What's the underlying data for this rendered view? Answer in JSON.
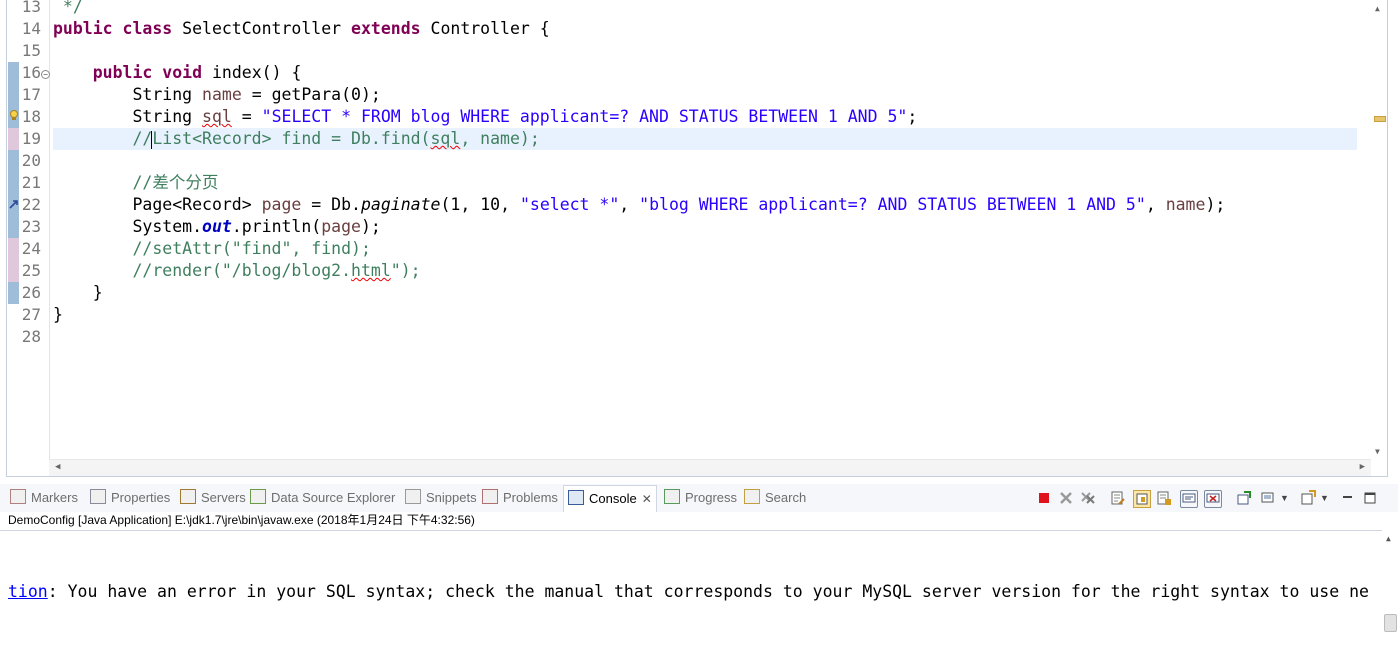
{
  "editor": {
    "lines": [
      {
        "num": "13",
        "parts": [
          {
            "t": " */",
            "c": "cmt"
          }
        ]
      },
      {
        "num": "14",
        "parts": [
          {
            "t": "public class ",
            "c": "kw"
          },
          {
            "t": "SelectController ",
            "c": ""
          },
          {
            "t": "extends ",
            "c": "kw"
          },
          {
            "t": "Controller {",
            "c": ""
          }
        ]
      },
      {
        "num": "15",
        "parts": []
      },
      {
        "num": "16",
        "fold": true,
        "parts": [
          {
            "t": "    ",
            "c": ""
          },
          {
            "t": "public void ",
            "c": "kw"
          },
          {
            "t": "index() {",
            "c": ""
          }
        ]
      },
      {
        "num": "17",
        "parts": [
          {
            "t": "        String ",
            "c": ""
          },
          {
            "t": "name",
            "c": "var"
          },
          {
            "t": " = getPara(0);",
            "c": ""
          }
        ]
      },
      {
        "num": "18",
        "warning": true,
        "parts": [
          {
            "t": "        String ",
            "c": ""
          },
          {
            "t": "sql",
            "c": "var squig"
          },
          {
            "t": " = ",
            "c": ""
          },
          {
            "t": "\"SELECT * FROM blog WHERE applicant=? AND STATUS BETWEEN 1 AND 5\"",
            "c": "str"
          },
          {
            "t": ";",
            "c": ""
          }
        ]
      },
      {
        "num": "19",
        "current": true,
        "parts": [
          {
            "t": "        //",
            "c": "cmt"
          },
          {
            "t": "",
            "c": "caret"
          },
          {
            "t": "List<Record> find = Db.find(",
            "c": "cmt"
          },
          {
            "t": "sql",
            "c": "cmt squig"
          },
          {
            "t": ", name);",
            "c": "cmt"
          }
        ]
      },
      {
        "num": "20",
        "parts": []
      },
      {
        "num": "21",
        "parts": [
          {
            "t": "        //差个分页",
            "c": "cmt"
          }
        ]
      },
      {
        "num": "22",
        "link": true,
        "parts": [
          {
            "t": "        Page<Record> ",
            "c": ""
          },
          {
            "t": "page",
            "c": "var"
          },
          {
            "t": " = Db.",
            "c": ""
          },
          {
            "t": "paginate",
            "c": "meth-i"
          },
          {
            "t": "(1, 10, ",
            "c": ""
          },
          {
            "t": "\"select *\"",
            "c": "str"
          },
          {
            "t": ", ",
            "c": ""
          },
          {
            "t": "\"blog WHERE applicant=? AND STATUS BETWEEN 1 AND 5\"",
            "c": "str"
          },
          {
            "t": ", ",
            "c": ""
          },
          {
            "t": "name",
            "c": "var"
          },
          {
            "t": ");",
            "c": ""
          }
        ]
      },
      {
        "num": "23",
        "parts": [
          {
            "t": "        System.",
            "c": ""
          },
          {
            "t": "out",
            "c": "fld"
          },
          {
            "t": ".println(",
            "c": ""
          },
          {
            "t": "page",
            "c": "var"
          },
          {
            "t": ");",
            "c": ""
          }
        ]
      },
      {
        "num": "24",
        "parts": [
          {
            "t": "        //setAttr(\"find\", find);",
            "c": "cmt"
          }
        ]
      },
      {
        "num": "25",
        "parts": [
          {
            "t": "        //render(\"/blog/blog2.",
            "c": "cmt"
          },
          {
            "t": "html",
            "c": "cmt squig"
          },
          {
            "t": "\");",
            "c": "cmt"
          }
        ]
      },
      {
        "num": "26",
        "parts": [
          {
            "t": "    }",
            "c": ""
          }
        ]
      },
      {
        "num": "27",
        "parts": [
          {
            "t": "}",
            "c": ""
          }
        ]
      },
      {
        "num": "28",
        "parts": []
      }
    ]
  },
  "views": {
    "tabs": [
      {
        "label": "Markers",
        "icon": "markers-icon"
      },
      {
        "label": "Properties",
        "icon": "properties-icon"
      },
      {
        "label": "Servers",
        "icon": "servers-icon"
      },
      {
        "label": "Data Source Explorer",
        "icon": "data-source-icon"
      },
      {
        "label": "Snippets",
        "icon": "snippets-icon"
      },
      {
        "label": "Problems",
        "icon": "problems-icon"
      },
      {
        "label": "Console",
        "icon": "console-icon",
        "active": true
      },
      {
        "label": "Progress",
        "icon": "progress-icon"
      },
      {
        "label": "Search",
        "icon": "search-icon"
      }
    ]
  },
  "console": {
    "launch_info": "DemoConfig [Java Application] E:\\jdk1.7\\jre\\bin\\javaw.exe (2018年1月24日 下午4:32:56)",
    "output_link": "tion",
    "output_text": ": You have an error in your SQL syntax; check the manual that corresponds to your MySQL server version for the right syntax to use ne"
  },
  "colors": {
    "keyword": "#7f0055",
    "string": "#2a00ff",
    "comment": "#3f7f5f",
    "field": "#0000c0",
    "current_line": "#e8f2fe",
    "terminate_button": "#e0121b"
  }
}
